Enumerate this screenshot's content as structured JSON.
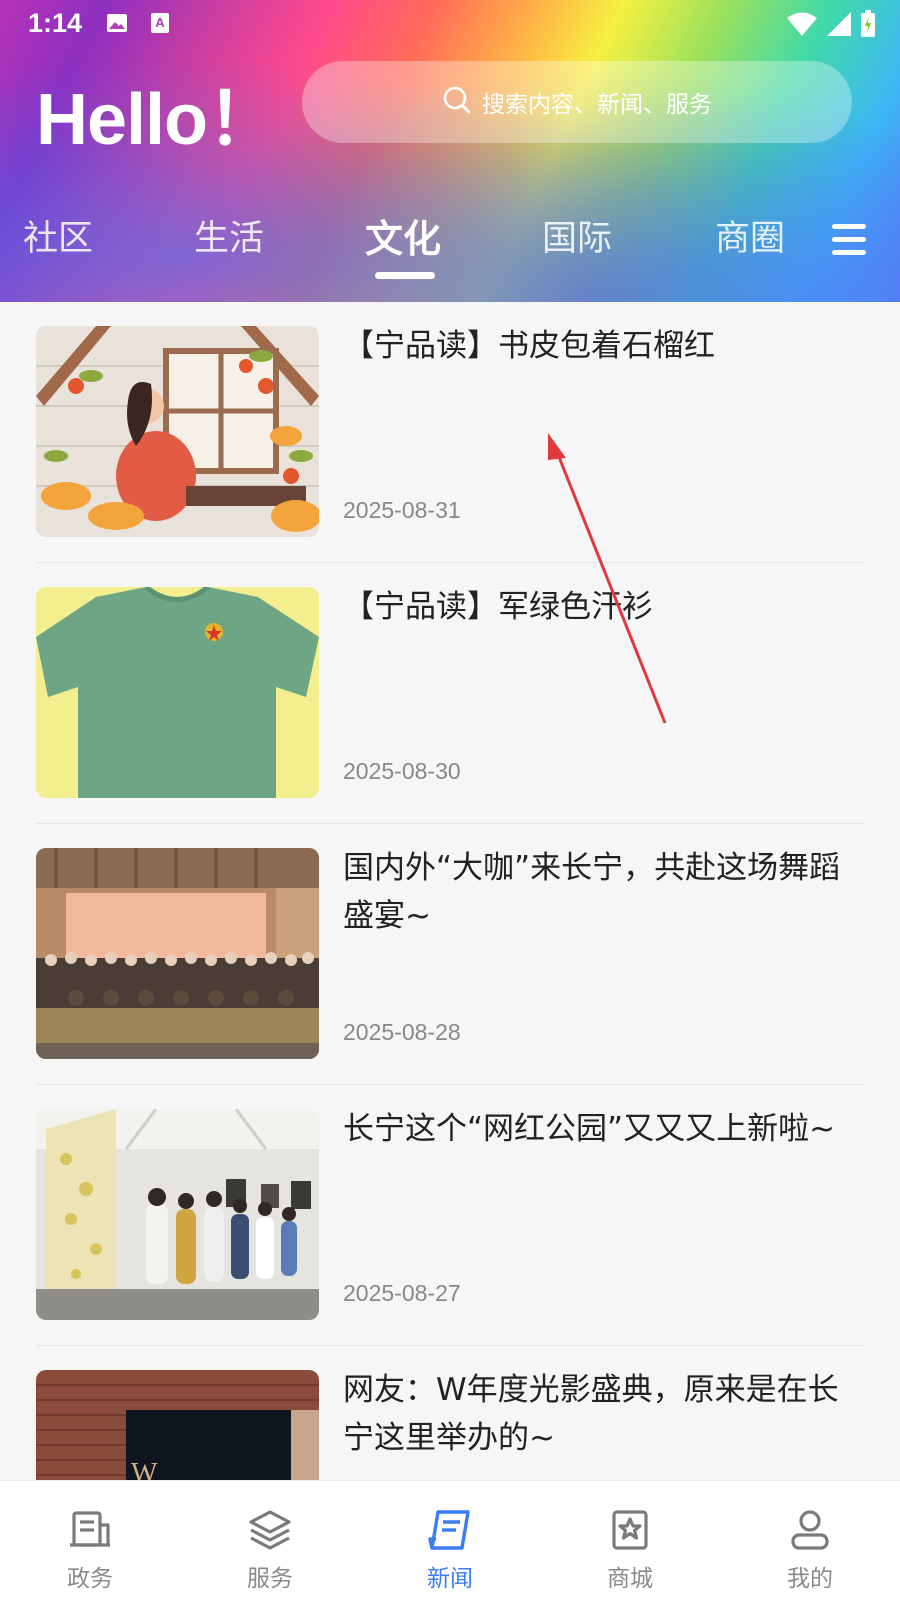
{
  "status_bar": {
    "time": "1:14",
    "left_icons": [
      "image-icon",
      "text-a-icon"
    ],
    "right_icons": [
      "wifi-icon",
      "signal-icon",
      "battery-icon"
    ]
  },
  "header": {
    "greeting": "Hello！",
    "search_placeholder": "搜索内容、新闻、服务"
  },
  "tabs": [
    {
      "label": "社区",
      "active": false
    },
    {
      "label": "生活",
      "active": false
    },
    {
      "label": "文化",
      "active": true
    },
    {
      "label": "国际",
      "active": false
    },
    {
      "label": "商圈",
      "active": false
    }
  ],
  "news": [
    {
      "title": "【宁品读】书皮包着石榴红",
      "date": "2025-08-31",
      "image": "illustration-girl-reading-window"
    },
    {
      "title": "【宁品读】军绿色汗衫",
      "date": "2025-08-30",
      "image": "green-t-shirt-photo"
    },
    {
      "title": "国内外“大咖”来长宁，共赴这场舞蹈盛宴~",
      "date": "2025-08-28",
      "image": "dance-group-photo"
    },
    {
      "title": "长宁这个“网红公园”又又又上新啦~",
      "date": "2025-08-27",
      "image": "art-exhibition-photo"
    },
    {
      "title": "网友：W年度光影盛典，原来是在长宁这里举办的~",
      "date": "",
      "image": "brick-building-photo"
    }
  ],
  "bottom_nav": [
    {
      "label": "政务",
      "icon": "government-icon",
      "active": false
    },
    {
      "label": "服务",
      "icon": "layers-icon",
      "active": false
    },
    {
      "label": "新闻",
      "icon": "news-icon",
      "active": true
    },
    {
      "label": "商城",
      "icon": "shop-icon",
      "active": false
    },
    {
      "label": "我的",
      "icon": "user-icon",
      "active": false
    }
  ],
  "colors": {
    "accent": "#3b7cf5",
    "nav_inactive": "#8a8a8a",
    "title_text": "#222222",
    "date_text": "#888888",
    "annotation_arrow": "#e0393e"
  }
}
